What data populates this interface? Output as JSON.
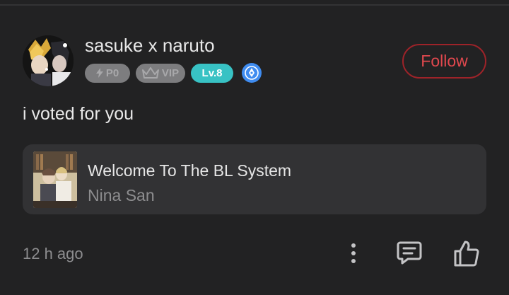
{
  "user": {
    "name": "sasuke x naruto",
    "badges": {
      "power": "P0",
      "vip": "VIP",
      "level": "Lv.8"
    }
  },
  "follow_label": "Follow",
  "comment_text": "i voted for you",
  "book": {
    "title": "Welcome To The BL System",
    "author": "Nina San"
  },
  "timestamp": "12 h ago",
  "icons": {
    "power": "lightning-icon",
    "vip": "crown-icon",
    "writer": "pen-nib-icon",
    "more": "more-vertical-icon",
    "reply": "comment-icon",
    "like": "thumbs-up-icon"
  },
  "colors": {
    "background": "#222223",
    "card": "#323234",
    "follow": "#e0484e",
    "level_badge": "#38c2c4",
    "writer_badge": "#3f8cf0",
    "muted_badge": "#7d7d7f"
  }
}
